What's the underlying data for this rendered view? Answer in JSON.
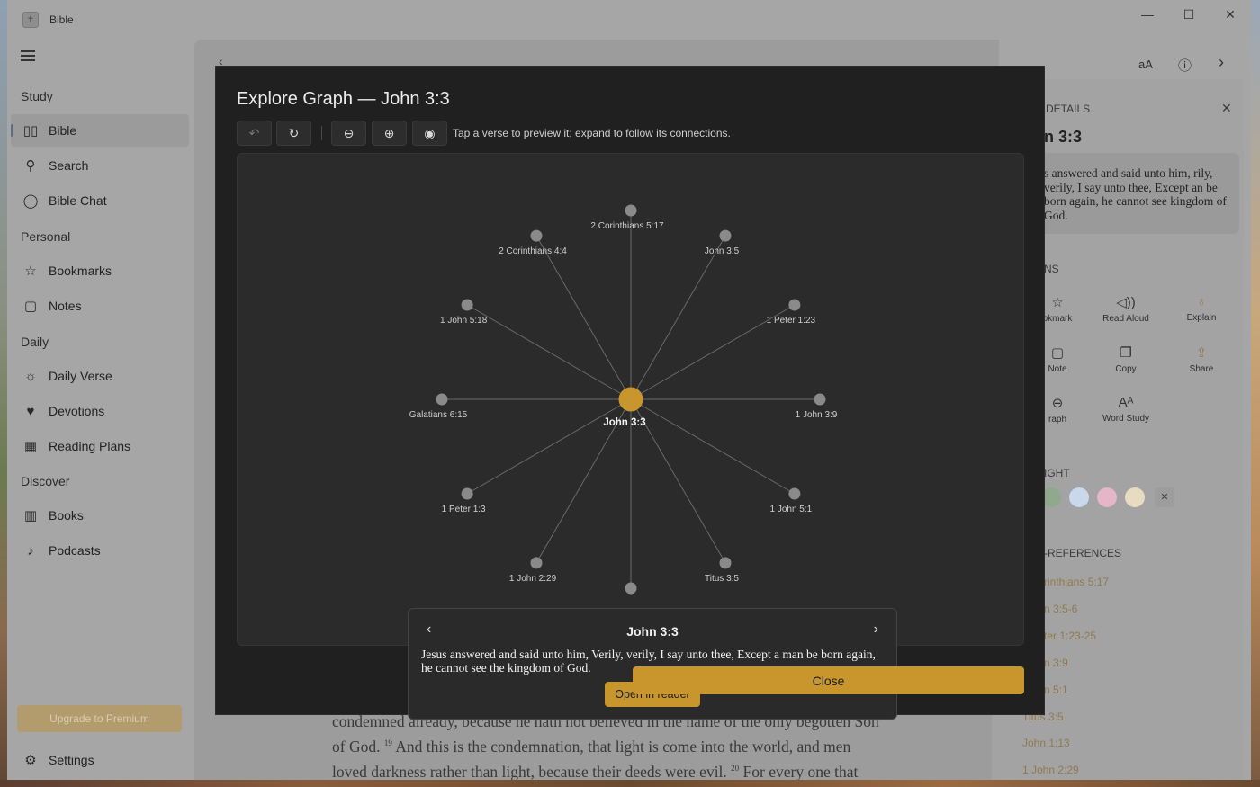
{
  "window": {
    "app_title": "Bible",
    "minimize": "—",
    "maximize": "☐",
    "close": "✕"
  },
  "sidebar": {
    "sections": [
      {
        "title": "Study"
      },
      {
        "title": "Personal"
      },
      {
        "title": "Daily"
      },
      {
        "title": "Discover"
      }
    ],
    "items": [
      {
        "label": "Bible",
        "icon": "book-icon",
        "active": true
      },
      {
        "label": "Search",
        "icon": "search-icon"
      },
      {
        "label": "Bible Chat",
        "icon": "chat-icon"
      },
      {
        "label": "Bookmarks",
        "icon": "star-icon"
      },
      {
        "label": "Notes",
        "icon": "note-icon"
      },
      {
        "label": "Daily Verse",
        "icon": "sun-icon"
      },
      {
        "label": "Devotions",
        "icon": "heart-icon"
      },
      {
        "label": "Reading Plans",
        "icon": "calendar-icon"
      },
      {
        "label": "Books",
        "icon": "library-icon"
      },
      {
        "label": "Podcasts",
        "icon": "microphone-icon"
      }
    ],
    "upgrade_label": "Upgrade to Premium",
    "settings_label": "Settings"
  },
  "reader": {
    "line1": "condemned already, because he hath not believed in the name of the only begotten Son",
    "line2a": "of God. ",
    "v19": "19",
    "line2b": " And this is the condemnation, that light is come into the world, and men",
    "line3a": "loved darkness rather than light, because their deeds were evil. ",
    "v20": "20",
    "line3b": " For every one that"
  },
  "right_panel": {
    "header": "DETAILS",
    "verse": "n 3:3",
    "verse_text": "s answered and said unto him, rily, verily, I say unto thee, Except an be born again, he cannot see kingdom of God.",
    "actions_header": "NS",
    "actions": [
      {
        "label": "okmark",
        "icon": "bookmark-icon"
      },
      {
        "label": "Read Aloud",
        "icon": "speaker-icon"
      },
      {
        "label": "Explain",
        "icon": "lightbulb-icon"
      },
      {
        "label": "Note",
        "icon": "note-icon"
      },
      {
        "label": "Copy",
        "icon": "copy-icon"
      },
      {
        "label": "Share",
        "icon": "share-icon"
      },
      {
        "label": "raph",
        "icon": "graph-icon"
      },
      {
        "label": "Word Study",
        "icon": "word-study-icon"
      }
    ],
    "highlight_header": "IGHT",
    "highlight_colors": [
      "#8fa88e",
      "#c9d8ea",
      "#e4b6c8",
      "#e8dcc0"
    ],
    "xref_header": "-REFERENCES",
    "xrefs": [
      "rinthians 5:17",
      "n 3:5-6",
      "ter 1:23-25",
      "n 3:9",
      "n 5:1",
      "Titus 3:5",
      "John 1:13",
      "1 John 2:29"
    ]
  },
  "modal": {
    "title": "Explore Graph — John 3:3",
    "hint": "Tap a verse to preview it; expand to follow its connections.",
    "close_label": "Close",
    "preview": {
      "title": "John 3:3",
      "text": "Jesus answered and said unto him, Verily, verily, I say unto thee, Except a man be born again, he cannot see the kingdom of God.",
      "open_label": "Open in reader"
    }
  },
  "graph": {
    "center": "John 3:3",
    "nodes": [
      {
        "label": "2 Corinthians 5:17"
      },
      {
        "label": "John 3:5"
      },
      {
        "label": "1 Peter 1:23"
      },
      {
        "label": "1 John 3:9"
      },
      {
        "label": "1 John 5:1"
      },
      {
        "label": "Titus 3:5"
      },
      {
        "label": ""
      },
      {
        "label": "1 John 2:29"
      },
      {
        "label": "1 Peter 1:3"
      },
      {
        "label": "Galatians 6:15"
      },
      {
        "label": "1 John 5:18"
      },
      {
        "label": "2 Corinthians 4:4"
      }
    ],
    "colors": {
      "center": "#c8962c",
      "node": "#8a8a8a",
      "edge": "#6a6a6a",
      "label": "#d0d0d0"
    }
  }
}
